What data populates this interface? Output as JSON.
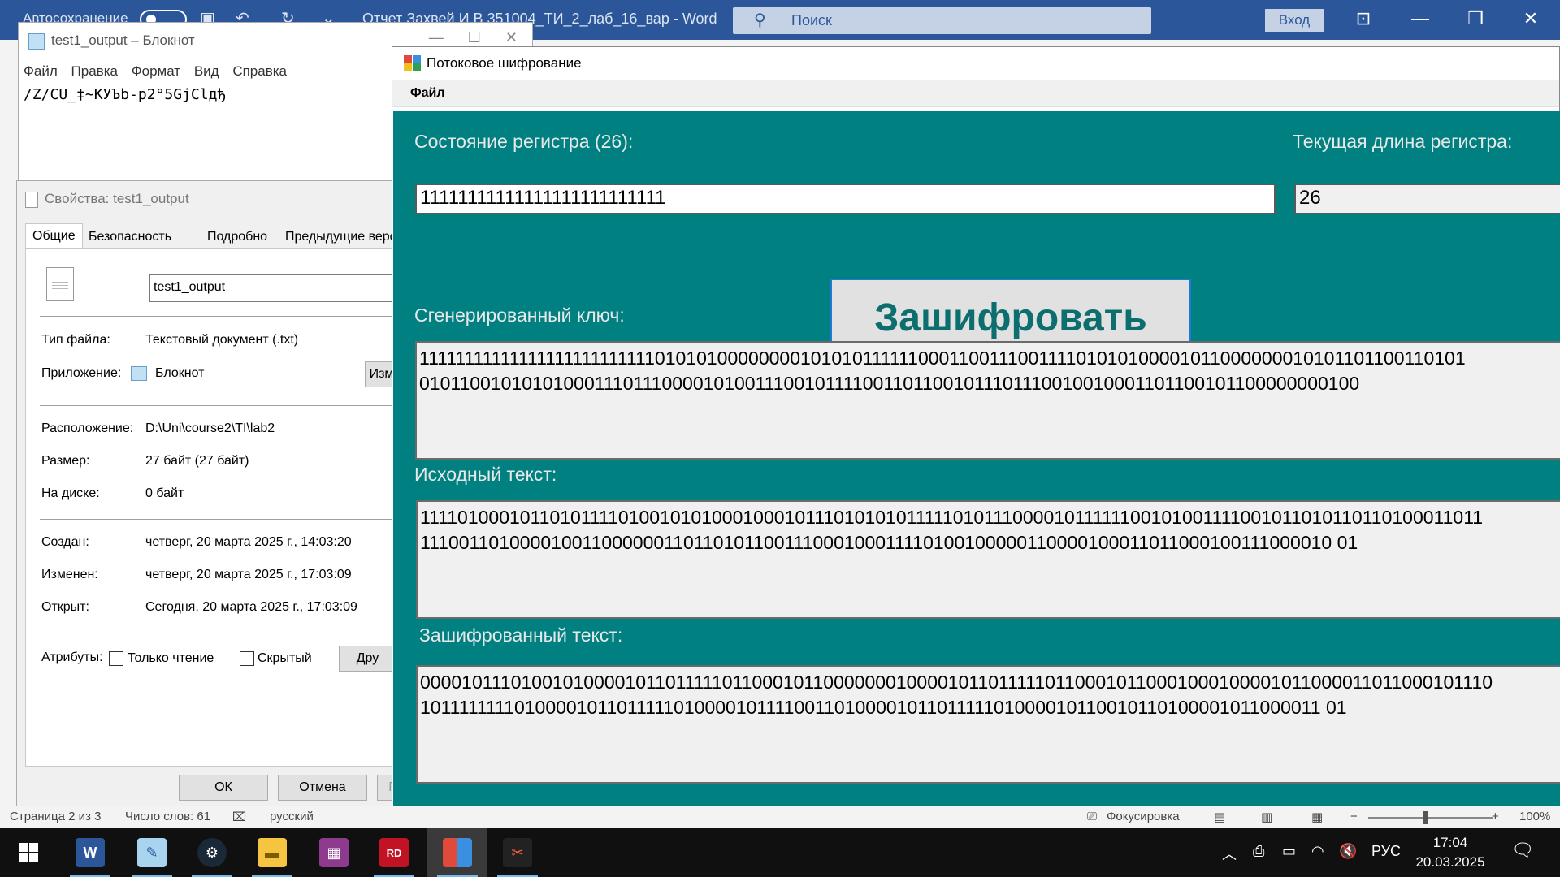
{
  "word": {
    "autosave": "Автосохранение",
    "doc_title": "Отчет Захвей И.В 351004_ТИ_2_лаб_16_вар  -  Word",
    "search_placeholder": "Поиск",
    "login": "Вход",
    "status": {
      "page": "Страница 2 из 3",
      "words": "Число слов: 61",
      "lang": "русский",
      "focus": "Фокусировка",
      "zoom": "100%"
    }
  },
  "notepad": {
    "title": "test1_output – Блокнот",
    "menu": [
      "Файл",
      "Правка",
      "Формат",
      "Вид",
      "Справка"
    ],
    "content": "/Z/CU_‡~KУЪb-p2°5GjClдђ"
  },
  "properties": {
    "title": "Свойства: test1_output",
    "tabs": [
      "Общие",
      "Безопасность",
      "Подробно",
      "Предыдущие версии"
    ],
    "file_name": "test1_output",
    "rows": {
      "type_label": "Тип файла:",
      "type_value": "Текстовый документ (.txt)",
      "app_label": "Приложение:",
      "app_value": "Блокнот",
      "change_btn": "Изм",
      "location_label": "Расположение:",
      "location_value": "D:\\Uni\\course2\\TI\\lab2",
      "size_label": "Размер:",
      "size_value": "27 байт (27 байт)",
      "disk_label": "На диске:",
      "disk_value": "0 байт",
      "created_label": "Создан:",
      "created_value": "четверг, 20 марта 2025 г., 14:03:20",
      "modified_label": "Изменен:",
      "modified_value": "четверг, 20 марта 2025 г., 17:03:09",
      "opened_label": "Открыт:",
      "opened_value": "Сегодня, 20 марта 2025 г., 17:03:09",
      "attr_label": "Атрибуты:",
      "readonly_label": "Только чтение",
      "hidden_label": "Скрытый",
      "other_btn": "Дру"
    },
    "buttons": {
      "ok": "ОК",
      "cancel": "Отмена",
      "apply": "П"
    }
  },
  "cipher": {
    "title": "Потоковое шифрование",
    "menu_file": "Файл",
    "register_label": "Состояние регистра (26):",
    "register_value": "11111111111111111111111111",
    "length_label": "Текущая длина регистра:",
    "length_value": "26",
    "encrypt_button": "Зашифровать",
    "key_label": "Сгенерированный ключ:",
    "key_line1": "1111111111111111111111111101010100000000101010111111000110011100111101010100001011000000010101101100110101",
    "key_line2": "010110010101010001110111000010100111001011110011011001011101110010010001101100101100000000100",
    "source_label": "Исходный текст:",
    "source_line1": "1111010001011010111101001010100010001011101010101111101011100001011111100101001111001011010110110100011011",
    "source_line2": "111001101000010011000000110110101100111000100011110100100000110000100011011000100111000010 01",
    "encrypted_label": "Зашифрованный текст:",
    "encrypted_line1": "0000101110100101000010110111110110001011000000010000101101111101100010110001000100001011000011011000101110",
    "encrypted_line2": "101111111101000010110111110100001011110011010000101101111101000010110010110100001011000011 01"
  },
  "taskbar": {
    "lang": "РУС",
    "time": "17:04",
    "date": "20.03.2025"
  }
}
